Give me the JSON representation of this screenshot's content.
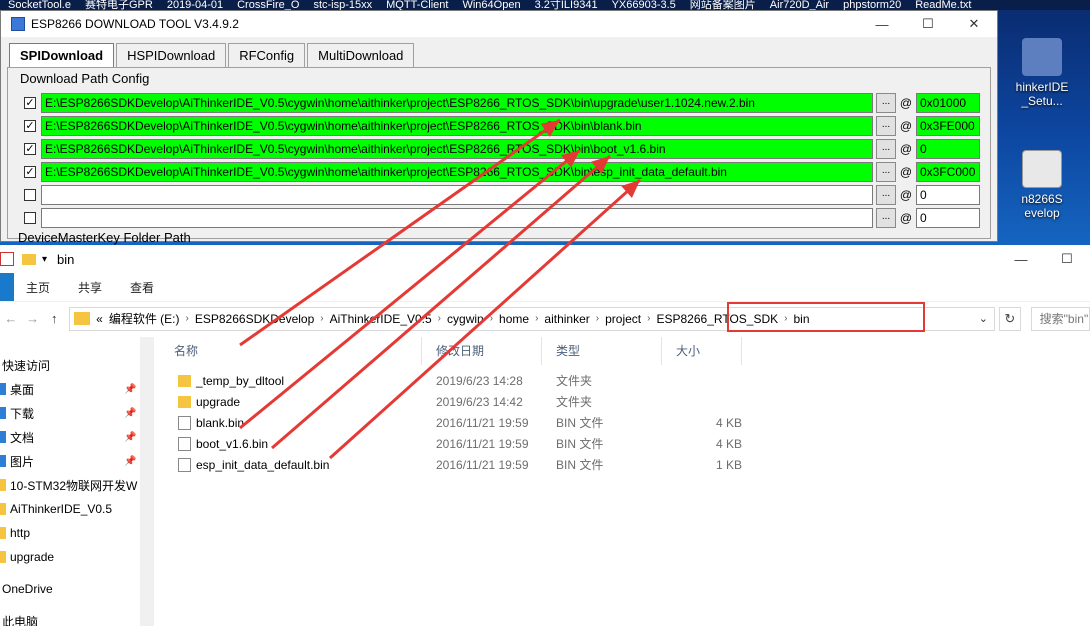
{
  "taskbar_top": [
    "SocketTool.e",
    "赛特电子GPR",
    "2019-04-01",
    "CrossFire_O",
    "stc-isp-15xx",
    "MQTT-Client",
    "Win64Open",
    "3.2寸ILI9341",
    "YX66903-3.5",
    "网站备案图片",
    "Air720D_Air",
    "phpstorm20",
    "ReadMe.txt"
  ],
  "desktop_icons": [
    {
      "label": "hinkerIDE\n_Setu..."
    },
    {
      "label": "n8266S\nevelop"
    }
  ],
  "esp_tool": {
    "title": "ESP8266 DOWNLOAD TOOL V3.4.9.2",
    "window_buttons": [
      "—",
      "☐",
      "✕"
    ],
    "tabs": [
      "SPIDownload",
      "HSPIDownload",
      "RFConfig",
      "MultiDownload"
    ],
    "group_label": "Download Path Config",
    "browse_label": "...",
    "at_label": "@",
    "rows": [
      {
        "checked": true,
        "check_mark": "✓",
        "path": "E:\\ESP8266SDKDevelop\\AiThinkerIDE_V0.5\\cygwin\\home\\aithinker\\project\\ESP8266_RTOS_SDK\\bin\\upgrade\\user1.1024.new.2.bin",
        "addr": "0x01000"
      },
      {
        "checked": true,
        "check_mark": "✓",
        "path": "E:\\ESP8266SDKDevelop\\AiThinkerIDE_V0.5\\cygwin\\home\\aithinker\\project\\ESP8266_RTOS_SDK\\bin\\blank.bin",
        "addr": "0x3FE000"
      },
      {
        "checked": true,
        "check_mark": "✓",
        "path": "E:\\ESP8266SDKDevelop\\AiThinkerIDE_V0.5\\cygwin\\home\\aithinker\\project\\ESP8266_RTOS_SDK\\bin\\boot_v1.6.bin",
        "addr": "0"
      },
      {
        "checked": true,
        "check_mark": "✓",
        "path": "E:\\ESP8266SDKDevelop\\AiThinkerIDE_V0.5\\cygwin\\home\\aithinker\\project\\ESP8266_RTOS_SDK\\bin\\esp_init_data_default.bin",
        "addr": "0x3FC000"
      },
      {
        "checked": false,
        "check_mark": "",
        "path": "",
        "addr": "0"
      },
      {
        "checked": false,
        "check_mark": "",
        "path": "",
        "addr": "0"
      }
    ],
    "devkey_label": "DeviceMasterKey Folder Path"
  },
  "explorer": {
    "title": "bin",
    "window_buttons": [
      "—",
      "☐"
    ],
    "ribbon_tabs": [
      "主页",
      "共享",
      "查看"
    ],
    "nav_arrows": [
      "←",
      "→",
      "↑"
    ],
    "crumb_prefix": "«",
    "breadcrumb": [
      "编程软件 (E:)",
      "ESP8266SDKDevelop",
      "AiThinkerIDE_V0.5",
      "cygwin",
      "home",
      "aithinker",
      "project",
      "ESP8266_RTOS_SDK",
      "bin"
    ],
    "crumb_separator": "›",
    "dropdown_glyph": "⌄",
    "refresh_glyph": "↻",
    "search_placeholder": "搜索\"bin\"",
    "columns": [
      "名称",
      "修改日期",
      "类型",
      "大小"
    ],
    "nav_items": [
      {
        "label": "快速访问",
        "pinned": false
      },
      {
        "label": "桌面",
        "pinned": true
      },
      {
        "label": "下载",
        "pinned": true
      },
      {
        "label": "文档",
        "pinned": true
      },
      {
        "label": "图片",
        "pinned": true
      },
      {
        "label": "10-STM32物联网开发W",
        "pinned": false
      },
      {
        "label": "AiThinkerIDE_V0.5",
        "pinned": false
      },
      {
        "label": "http",
        "pinned": false
      },
      {
        "label": "upgrade",
        "pinned": false
      },
      {
        "label": "OneDrive",
        "pinned": false
      },
      {
        "label": "此电脑",
        "pinned": false
      }
    ],
    "pin_glyph": "📌",
    "files": [
      {
        "name": "_temp_by_dltool",
        "date": "2019/6/23 14:28",
        "type": "文件夹",
        "size": "",
        "kind": "folder"
      },
      {
        "name": "upgrade",
        "date": "2019/6/23 14:42",
        "type": "文件夹",
        "size": "",
        "kind": "folder"
      },
      {
        "name": "blank.bin",
        "date": "2016/11/21 19:59",
        "type": "BIN 文件",
        "size": "4 KB",
        "kind": "file"
      },
      {
        "name": "boot_v1.6.bin",
        "date": "2016/11/21 19:59",
        "type": "BIN 文件",
        "size": "4 KB",
        "kind": "file"
      },
      {
        "name": "esp_init_data_default.bin",
        "date": "2016/11/21 19:59",
        "type": "BIN 文件",
        "size": "1 KB",
        "kind": "file"
      }
    ]
  },
  "colors": {
    "highlight_green": "#00ff00",
    "annotation_red": "#e53935"
  }
}
